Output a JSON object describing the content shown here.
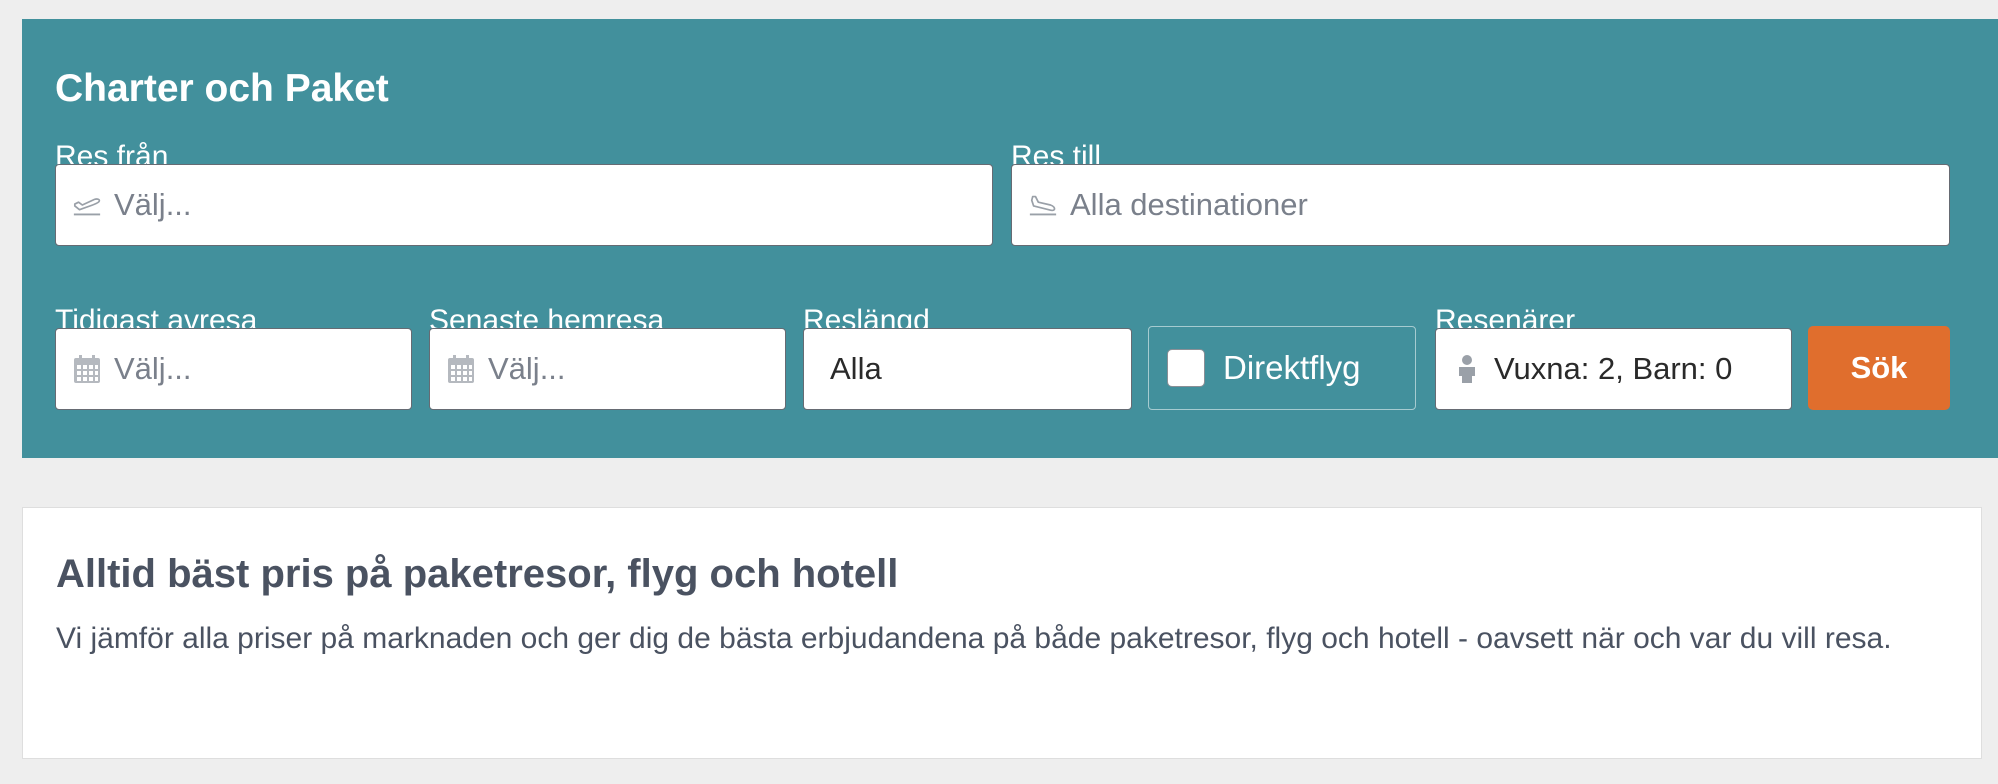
{
  "search_panel": {
    "title": "Charter och Paket",
    "from": {
      "label": "Res från",
      "placeholder": "Välj..."
    },
    "to": {
      "label": "Res till",
      "placeholder": "Alla destinationer"
    },
    "earliest_departure": {
      "label": "Tidigast avresa",
      "placeholder": "Välj..."
    },
    "latest_return": {
      "label": "Senaste hemresa",
      "placeholder": "Välj..."
    },
    "duration": {
      "label": "Reslängd",
      "value": "Alla"
    },
    "direct_flight": {
      "label": "Direktflyg",
      "checked": false
    },
    "travelers": {
      "label": "Resenärer",
      "value": "Vuxna: 2, Barn: 0"
    },
    "search_button": "Sök"
  },
  "info_card": {
    "title": "Alltid bäst pris på paketresor, flyg och hotell",
    "text": "Vi jämför alla priser på marknaden och ger dig de bästa erbjudandena på både paketresor, flyg och hotell - oavsett när och var du vill resa."
  },
  "icons": {
    "from": "plane-departure-icon",
    "to": "plane-arrival-icon",
    "dates": "calendar-icon",
    "travelers": "person-icon"
  },
  "colors": {
    "panel_background": "#42909c",
    "search_button": "#e06e2d",
    "page_background": "#eeeeee",
    "text_dark": "#4a5261"
  }
}
